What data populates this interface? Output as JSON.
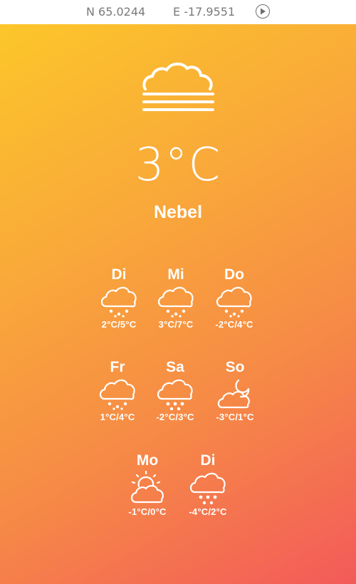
{
  "top_bar": {
    "latitude": "N 65.0244",
    "longitude": "E -17.9551",
    "play_icon": "play-circle-icon"
  },
  "current": {
    "icon": "fog-icon",
    "temperature": "3°C",
    "condition": "Nebel"
  },
  "forecast": [
    {
      "day": "Di",
      "icon": "rain-cloud-icon",
      "range": "2°C/5°C"
    },
    {
      "day": "Mi",
      "icon": "rain-cloud-icon",
      "range": "3°C/7°C"
    },
    {
      "day": "Do",
      "icon": "rain-cloud-icon",
      "range": "-2°C/4°C"
    },
    {
      "day": "Fr",
      "icon": "rain-cloud-icon",
      "range": "1°C/4°C"
    },
    {
      "day": "Sa",
      "icon": "snow-cloud-icon",
      "range": "-2°C/3°C"
    },
    {
      "day": "So",
      "icon": "cloud-moon-icon",
      "range": "-3°C/1°C"
    },
    {
      "day": "Mo",
      "icon": "cloud-sun-icon",
      "range": "-1°C/0°C"
    },
    {
      "day": "Di",
      "icon": "snow-cloud-icon",
      "range": "-4°C/2°C"
    }
  ],
  "colors": {
    "gradient_start": "#fcc62a",
    "gradient_end": "#f35a5a",
    "text": "#ffffff",
    "topbar_text": "#7a7a7a"
  }
}
